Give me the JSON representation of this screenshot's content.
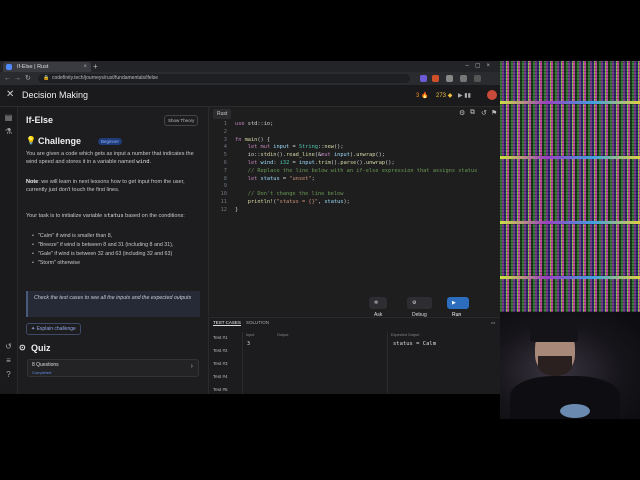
{
  "browser": {
    "tab_title": "If-Else | Rust",
    "url": "codefinity.tech/journeys/rust/fundamentals/ifelse"
  },
  "header": {
    "title": "Decision Making",
    "streak": "3",
    "gems": "273"
  },
  "lesson": {
    "title": "If-Else",
    "show_theory": "Show Theory",
    "challenge_label": "Challenge",
    "difficulty": "Beginner",
    "p1_a": "You are given a code which gets as input a number that indicates the wind speed and stores it in a variable named ",
    "p1_code": "wind",
    "p1_b": ".",
    "note_bold": "Note",
    "note_text": ": we will learn in next lessons how to get input from the user, currently just don't touch the first lines.",
    "task_a": "Your task is to initialize variable ",
    "task_code": "status",
    "task_b": " based on the conditions:",
    "conditions": [
      "\"Calm\" if wind is smaller than 8,",
      "\"Breeze\" if wind is between 8 and 31 (including 8 and 31),",
      "\"Gale\" if wind is between 32 and 63 (including 32 and 63)",
      "\"Storm\" otherwise"
    ],
    "hint": "Check the test cases to see all the inputs and the expected outputs",
    "explain": "Explain challenge"
  },
  "quiz": {
    "title": "Quiz",
    "count": "8 Questions",
    "status": "Completed"
  },
  "editor": {
    "language_tab": "Rust",
    "ask_ai": "Ask AI",
    "debug": "Debug",
    "run": "Run Code",
    "line_numbers": [
      "1",
      "2",
      "3",
      "4",
      "5",
      "6",
      "7",
      "8",
      "9",
      "10",
      "11",
      "12"
    ]
  },
  "tests": {
    "tab_cases": "TEST CASES",
    "tab_solution": "SOLUTION",
    "items": [
      "Test #1",
      "Test #2",
      "Test #3",
      "Test #4",
      "Test #5"
    ],
    "col_input": "Input",
    "col_output": "Output",
    "col_expected": "Expected Output",
    "input_value": "3",
    "expected_value": "status = Calm"
  },
  "icons": [
    "close-icon",
    "bulb-icon",
    "quiz-icon",
    "chevron-right-icon",
    "play-icon",
    "bug-icon",
    "ai-icon"
  ]
}
